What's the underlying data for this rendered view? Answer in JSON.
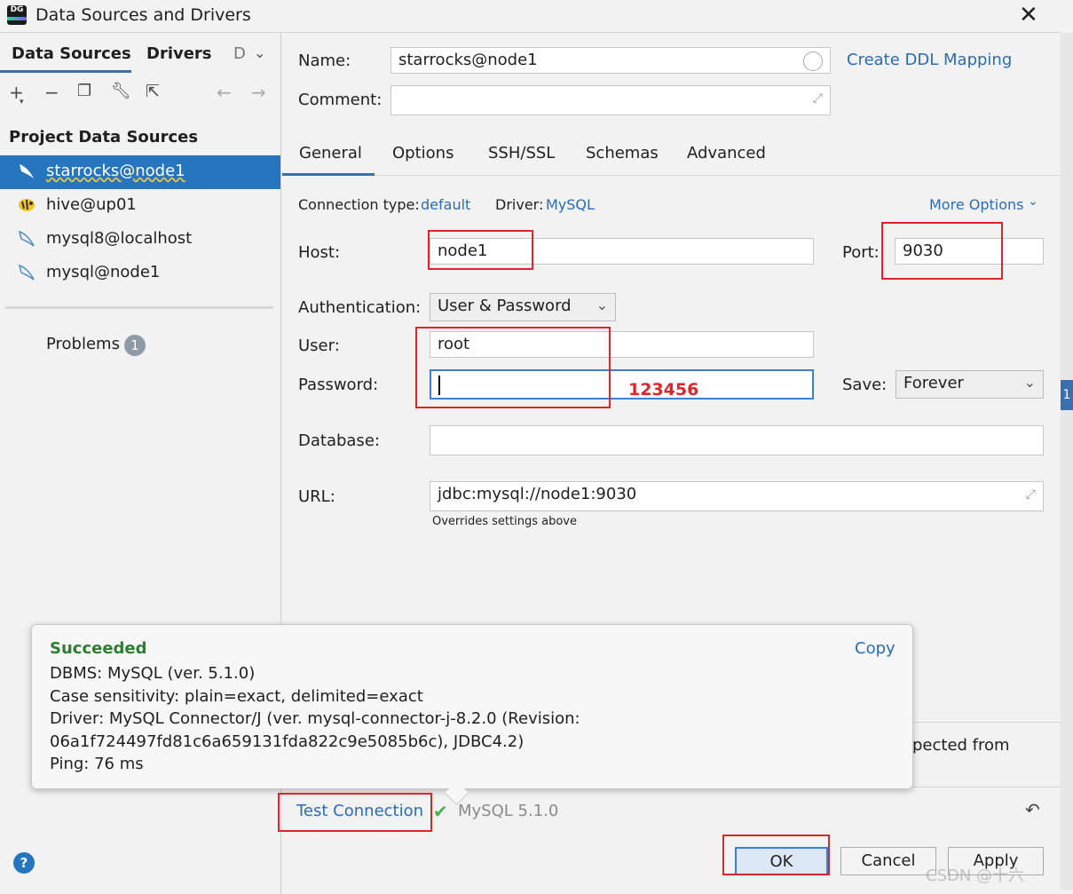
{
  "window": {
    "title": "Data Sources and Drivers",
    "app_badge": "DG"
  },
  "left": {
    "tabs": [
      "Data Sources",
      "Drivers",
      "D"
    ],
    "section_title": "Project Data Sources",
    "items": [
      {
        "label": "starrocks@node1",
        "icon": "dolphin-icon"
      },
      {
        "label": "hive@up01",
        "icon": "bee-icon"
      },
      {
        "label": "mysql8@localhost",
        "icon": "dolphin-icon"
      },
      {
        "label": "mysql@node1",
        "icon": "dolphin-icon"
      }
    ],
    "problems_label": "Problems",
    "problems_count": "1"
  },
  "form": {
    "name_label": "Name:",
    "name_value": "starrocks@node1",
    "comment_label": "Comment:",
    "create_ddl": "Create DDL Mapping",
    "tabs": [
      "General",
      "Options",
      "SSH/SSL",
      "Schemas",
      "Advanced"
    ],
    "conn_type_label": "Connection type:",
    "conn_type_value": "default",
    "driver_label": "Driver:",
    "driver_value": "MySQL",
    "more_options": "More Options",
    "host_label": "Host:",
    "host_value": "node1",
    "port_label": "Port:",
    "port_value": "9030",
    "auth_label": "Authentication:",
    "auth_value": "User & Password",
    "user_label": "User:",
    "user_value": "root",
    "password_label": "Password:",
    "password_annotation": "123456",
    "save_label": "Save:",
    "save_value": "Forever",
    "database_label": "Database:",
    "url_label": "URL:",
    "url_value": "jdbc:mysql://node1:9030",
    "url_hint": "Overrides settings above",
    "partial_text": "pected from"
  },
  "popup": {
    "status": "Succeeded",
    "copy": "Copy",
    "lines": [
      "DBMS: MySQL (ver. 5.1.0)",
      "Case sensitivity: plain=exact, delimited=exact",
      "Driver: MySQL Connector/J (ver. mysql-connector-j-8.2.0 (Revision:",
      "06a1f724497fd81c6a659131fda822c9e5085b6c), JDBC4.2)",
      "Ping: 76 ms"
    ]
  },
  "footer": {
    "test_connection": "Test Connection",
    "test_result": "MySQL 5.1.0",
    "ok": "OK",
    "cancel": "Cancel",
    "apply": "Apply",
    "help": "?",
    "watermark": "CSDN @十六"
  },
  "colors": {
    "accent": "#2675bf",
    "link": "#2a6cb4",
    "success": "#2f7d32",
    "annotation": "#e0242a"
  }
}
